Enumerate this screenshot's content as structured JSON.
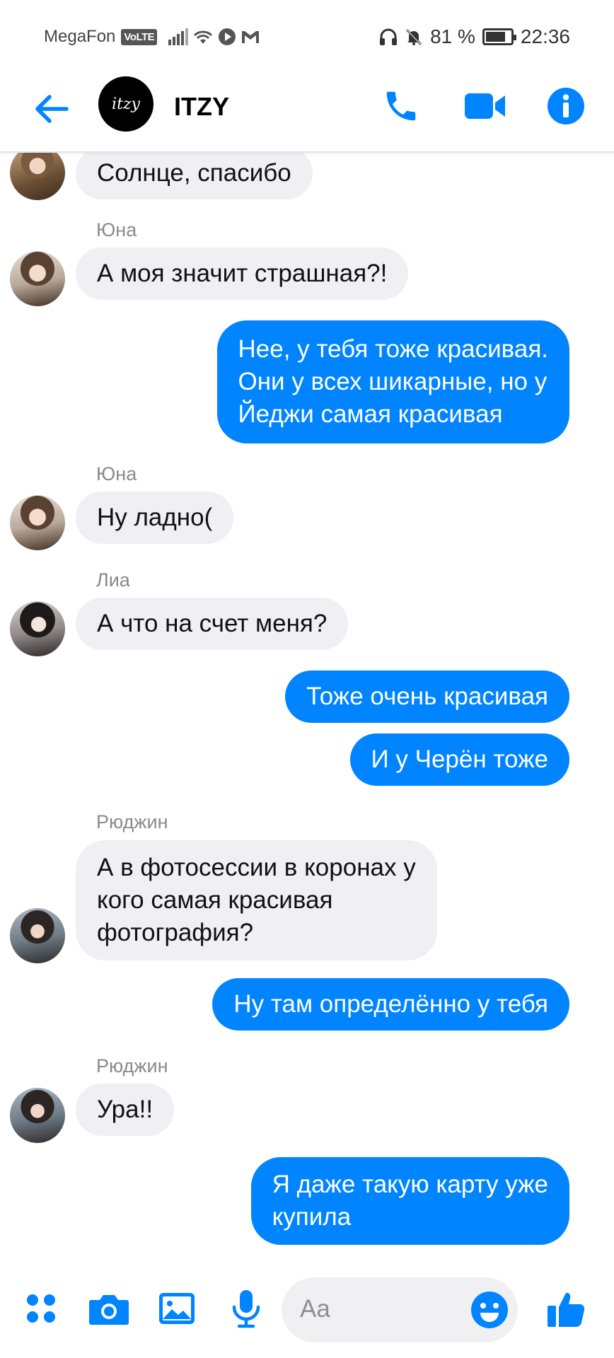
{
  "status_bar": {
    "carrier": "MegaFon",
    "volte": "VoLTE",
    "battery_percent": "81 %",
    "battery_level": 0.81,
    "time": "22:36"
  },
  "header": {
    "avatar_text": "itzy",
    "title": "ITZY"
  },
  "messages": [
    {
      "text": "Солнце, спасибо"
    },
    {
      "sender": "Юна",
      "text": "А моя значит страшная?!"
    },
    {
      "lines": [
        "Нее, у тебя тоже красивая.",
        "Они у всех шикарные, но у",
        "Йеджи самая красивая"
      ]
    },
    {
      "sender": "Юна",
      "text": "Ну ладно("
    },
    {
      "sender": "Лиа",
      "text": "А что на счет меня?"
    },
    {
      "text": "Тоже очень красивая"
    },
    {
      "text": "И у Черён тоже"
    },
    {
      "sender": "Рюджин",
      "lines": [
        "А в фотосессии в коронах у",
        "кого самая красивая",
        "фотография?"
      ]
    },
    {
      "text": "Ну там определённо у тебя"
    },
    {
      "sender": "Рюджин",
      "text": "Ура!!"
    },
    {
      "lines": [
        "Я даже такую карту уже",
        "купила"
      ]
    }
  ],
  "composer": {
    "placeholder": "Aa"
  },
  "colors": {
    "accent": "#0084ff",
    "incoming_bubble": "#f0eff4"
  },
  "icons": {
    "header": [
      "back-arrow-icon",
      "phone-icon",
      "video-camera-icon",
      "info-icon"
    ],
    "bottom": [
      "apps-grid-icon",
      "camera-icon",
      "gallery-icon",
      "microphone-icon",
      "emoji-icon",
      "thumbs-up-icon"
    ]
  }
}
